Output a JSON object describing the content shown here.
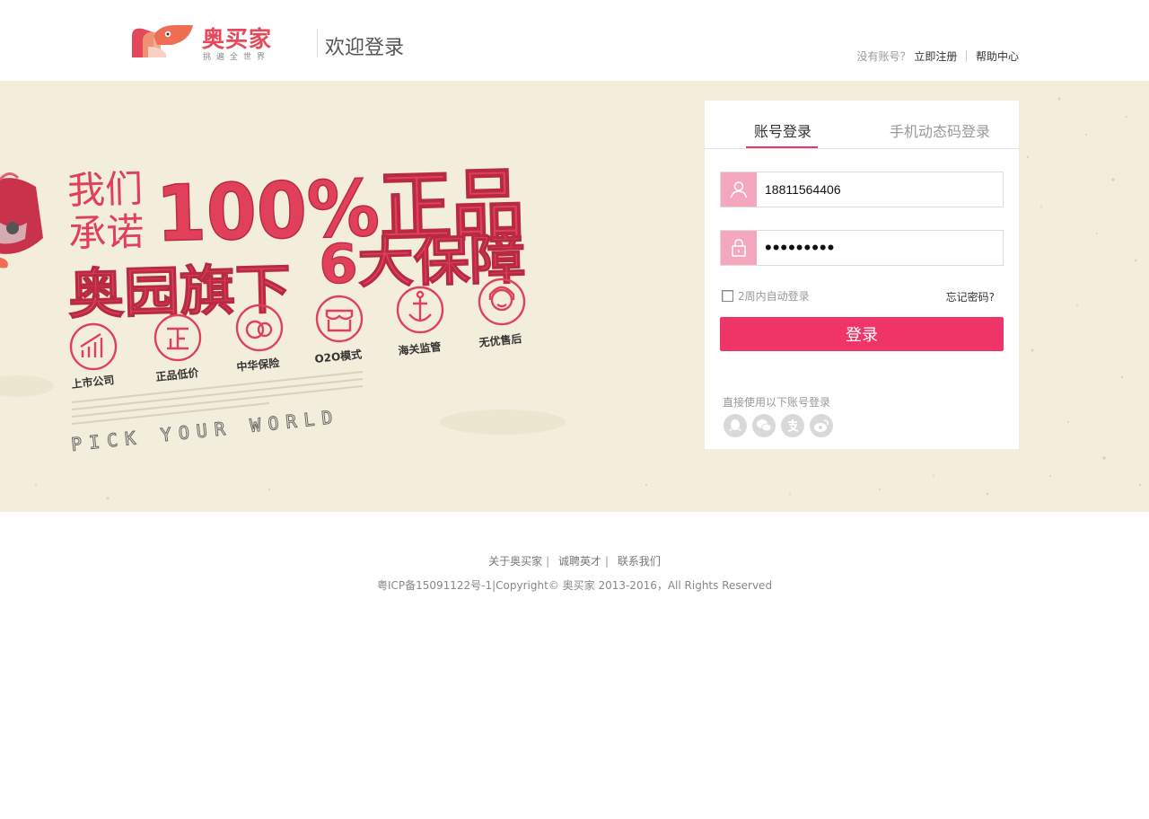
{
  "header": {
    "logo_name": "奥买家",
    "logo_slogan": "挑遍全世界",
    "welcome_title": "欢迎登录",
    "no_account_text": "没有账号？",
    "register_link": "立即注册",
    "help_link": "帮助中心"
  },
  "banner": {
    "promise_line1": "我们",
    "promise_line2": "承诺",
    "headline": "100%正品",
    "subline_brand": "奥园旗下",
    "subline_guarantee": "6大保障",
    "features": [
      {
        "label": "上市公司",
        "icon": "chart-icon"
      },
      {
        "label": "正品低价",
        "icon": "genuine-icon"
      },
      {
        "label": "中华保险",
        "icon": "insurance-icon"
      },
      {
        "label": "O2O模式",
        "icon": "store-icon"
      },
      {
        "label": "海关监管",
        "icon": "anchor-icon"
      },
      {
        "label": "无优售后",
        "icon": "service-icon"
      }
    ],
    "tagline": "PICK YOUR WORLD"
  },
  "login": {
    "tabs": [
      {
        "label": "账号登录",
        "active": true
      },
      {
        "label": "手机动态码登录",
        "active": false
      }
    ],
    "username_value": "18811564406",
    "password_value": "•••••••••",
    "remember_label": "2周内自动登录",
    "remember_checked": false,
    "forgot_link": "忘记密码?",
    "submit_label": "登录",
    "third_party_label": "直接使用以下账号登录",
    "third_party_icons": [
      "qq-icon",
      "wechat-icon",
      "alipay-icon",
      "weibo-icon"
    ]
  },
  "footer": {
    "links": [
      "关于奥买家",
      "诚聘英才",
      "联系我们"
    ],
    "separator": "|",
    "copyright": "粤ICP备15091122号-1|Copyright© 奥买家 2013-2016，All Rights Reserved"
  },
  "colors": {
    "brand_pink": "#ef3567",
    "icon_pink": "#f5a7bd",
    "banner_bg": "#f3eedb",
    "headline_red": "#e0405a"
  }
}
